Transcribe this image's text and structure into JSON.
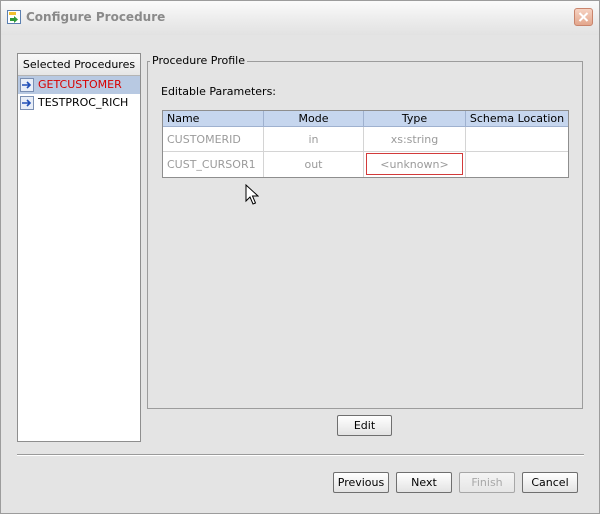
{
  "window": {
    "title": "Configure Procedure"
  },
  "procedures": {
    "header": "Selected Procedures",
    "items": [
      {
        "label": "GETCUSTOMER",
        "selected": true
      },
      {
        "label": "TESTPROC_RICH",
        "selected": false
      }
    ]
  },
  "profile": {
    "group_title": "Procedure Profile",
    "params_label": "Editable Parameters:",
    "columns": [
      "Name",
      "Mode",
      "Type",
      "Schema Location"
    ],
    "rows": [
      {
        "name": "CUSTOMERID",
        "mode": "in",
        "type": "xs:string",
        "schema_location": ""
      },
      {
        "name": "CUST_CURSOR1",
        "mode": "out",
        "type": "<unknown>",
        "schema_location": ""
      }
    ]
  },
  "buttons": {
    "edit": "Edit",
    "previous": "Previous",
    "next": "Next",
    "finish": "Finish",
    "cancel": "Cancel"
  },
  "colors": {
    "selected_proc_text": "#d80000",
    "selected_row_bg": "#b8c9e2",
    "table_header_bg": "#c6d6ee",
    "editing_cell_border": "#d23a3a"
  },
  "icons": {
    "title": "procedure-config-icon",
    "close": "close-icon",
    "procedure": "procedure-icon"
  }
}
